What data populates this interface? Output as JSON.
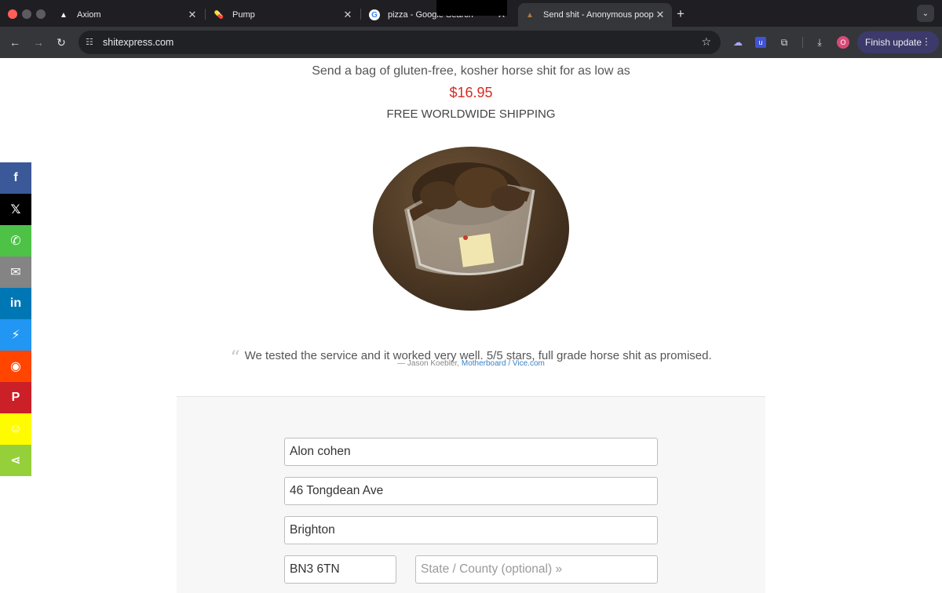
{
  "browser": {
    "tabs": [
      {
        "title": "Axiom",
        "favicon": "axiom-icon"
      },
      {
        "title": "Pump",
        "favicon": "pill-icon"
      },
      {
        "title": "pizza - Google Search",
        "favicon": "google-icon"
      },
      {
        "title": "Send shit - Anonymous poop",
        "favicon": "poop-icon",
        "active": true
      }
    ],
    "url": "shitexpress.com",
    "finish_update_label": "Finish update",
    "profile_initial": "O",
    "ext_u_label": "u"
  },
  "hero": {
    "tagline": "Send a bag of gluten-free, kosher horse shit for as low as",
    "price": "$16.95",
    "shipping": "FREE WORLDWIDE SHIPPING"
  },
  "testimonial": {
    "quote": "We tested the service and it worked very well. 5/5 stars, full grade horse shit as promised.",
    "author": "— Jason Koebler,",
    "source": "Motherboard / Vice.com"
  },
  "form": {
    "name_value": "Alon cohen",
    "street_value": "46 Tongdean Ave",
    "city_value": "Brighton",
    "postcode_value": "BN3 6TN",
    "state_placeholder": "State / County (optional) »"
  },
  "share_bar": [
    {
      "name": "facebook",
      "glyph": "f",
      "color": "#3b5998"
    },
    {
      "name": "x",
      "glyph": "𝕏",
      "color": "#000000"
    },
    {
      "name": "whatsapp",
      "glyph": "✆",
      "color": "#4dc247"
    },
    {
      "name": "email",
      "glyph": "✉",
      "color": "#848484"
    },
    {
      "name": "linkedin",
      "glyph": "in",
      "color": "#0077b5"
    },
    {
      "name": "messenger",
      "glyph": "⚡",
      "color": "#2196f3"
    },
    {
      "name": "reddit",
      "glyph": "◉",
      "color": "#ff4500"
    },
    {
      "name": "pinterest",
      "glyph": "P",
      "color": "#cb2027"
    },
    {
      "name": "snapchat",
      "glyph": "☺",
      "color": "#fffc00"
    },
    {
      "name": "share",
      "glyph": "⋖",
      "color": "#95d03a"
    }
  ]
}
